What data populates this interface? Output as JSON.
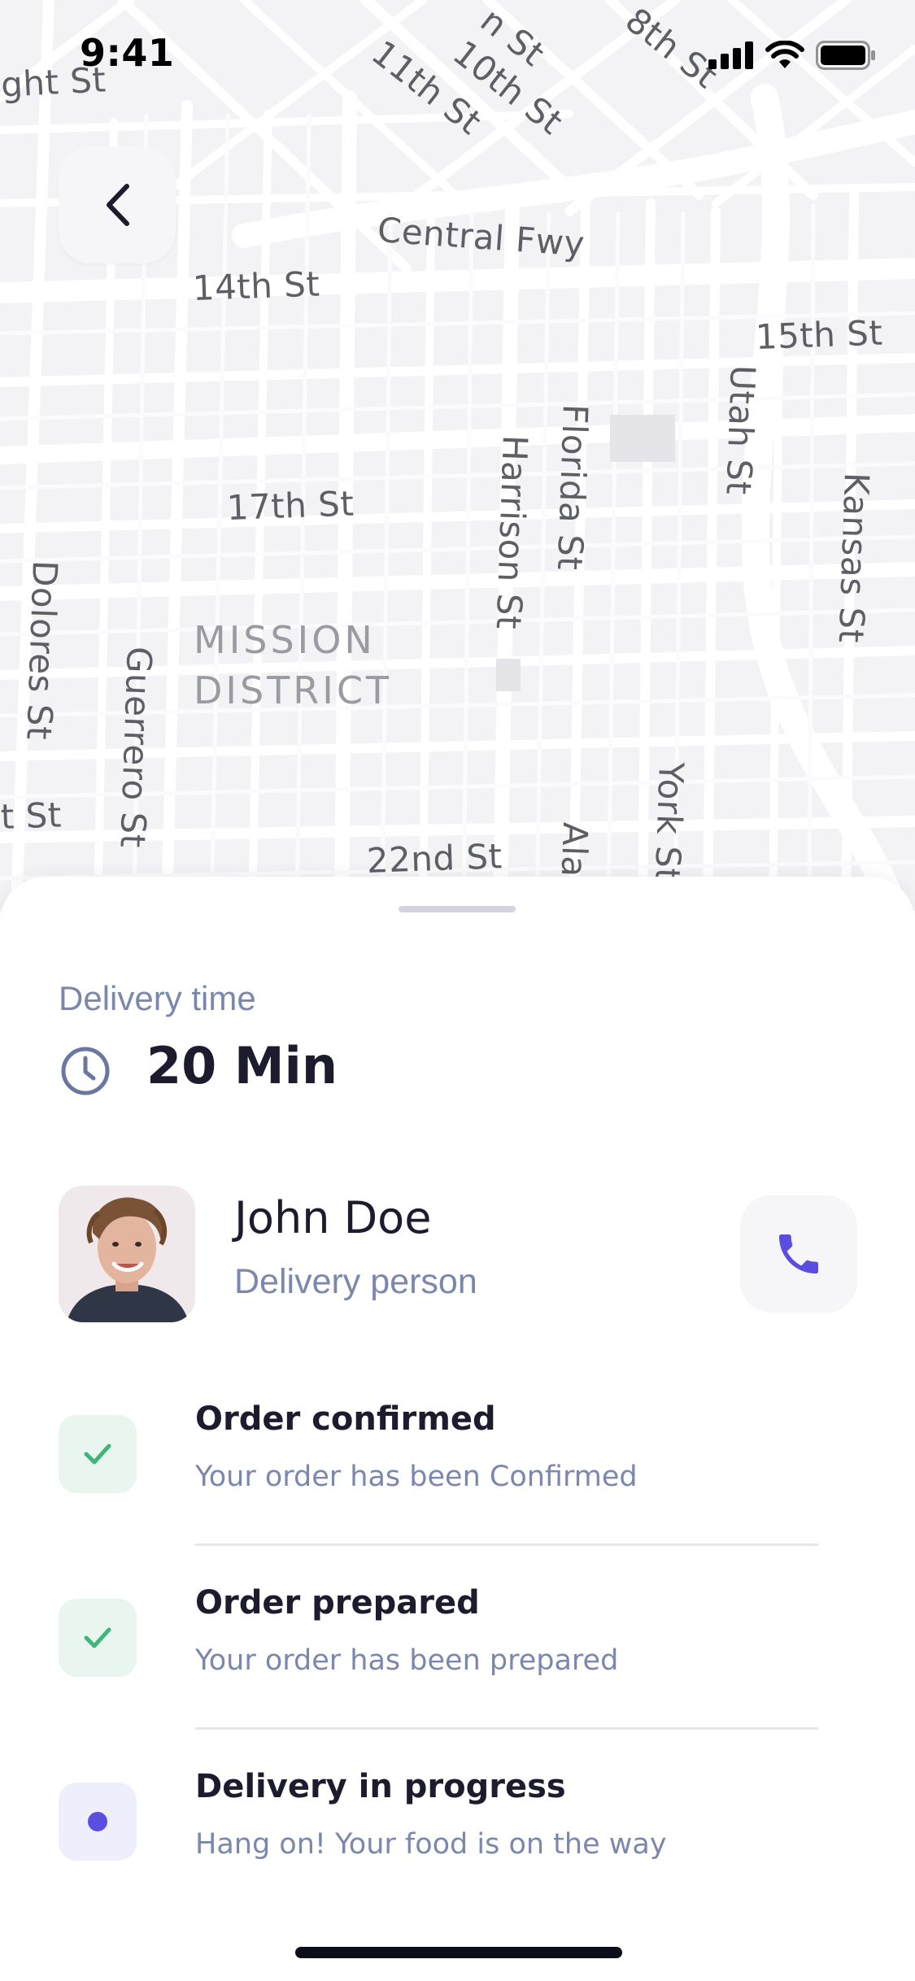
{
  "status_bar": {
    "time": "9:41"
  },
  "map": {
    "labels": {
      "eighth_st_left": "ght St",
      "n_st": "n St",
      "eighth_st": "8th St",
      "eleventh_st": "11th St",
      "tenth_st": "10th St",
      "central_fwy": "Central Fwy",
      "fourteenth_st": "14th St",
      "fifteenth_st": "15th St",
      "utah_st": "Utah St",
      "florida_st": "Florida St",
      "harrison_st": "Harrison St",
      "seventeenth_st": "17th St",
      "kansas_st": "Kansas St",
      "dolores_st": "Dolores St",
      "guerrero_st": "Guerrero St",
      "mission_district": "MISSION DISTRICT",
      "t_st": "t St",
      "twenty_second_st": "22nd St",
      "york_st": "York St",
      "ala": "Ala"
    }
  },
  "delivery": {
    "label": "Delivery time",
    "value": "20 Min"
  },
  "courier": {
    "name": "John Doe",
    "role": "Delivery person"
  },
  "steps": [
    {
      "title": "Order confirmed",
      "subtitle": "Your order has been Confirmed",
      "state": "done"
    },
    {
      "title": "Order prepared",
      "subtitle": "Your order has been prepared",
      "state": "done"
    },
    {
      "title": "Delivery in progress",
      "subtitle": "Hang on! Your food is on the way",
      "state": "active"
    }
  ],
  "colors": {
    "accent": "#5b4de0",
    "success": "#3fb57c",
    "text_primary": "#1d1b2e",
    "text_secondary": "#7b87ad"
  },
  "icons": {
    "back": "chevron-left-icon",
    "clock": "clock-icon",
    "call": "phone-icon",
    "done": "check-icon",
    "active": "dot-icon"
  }
}
